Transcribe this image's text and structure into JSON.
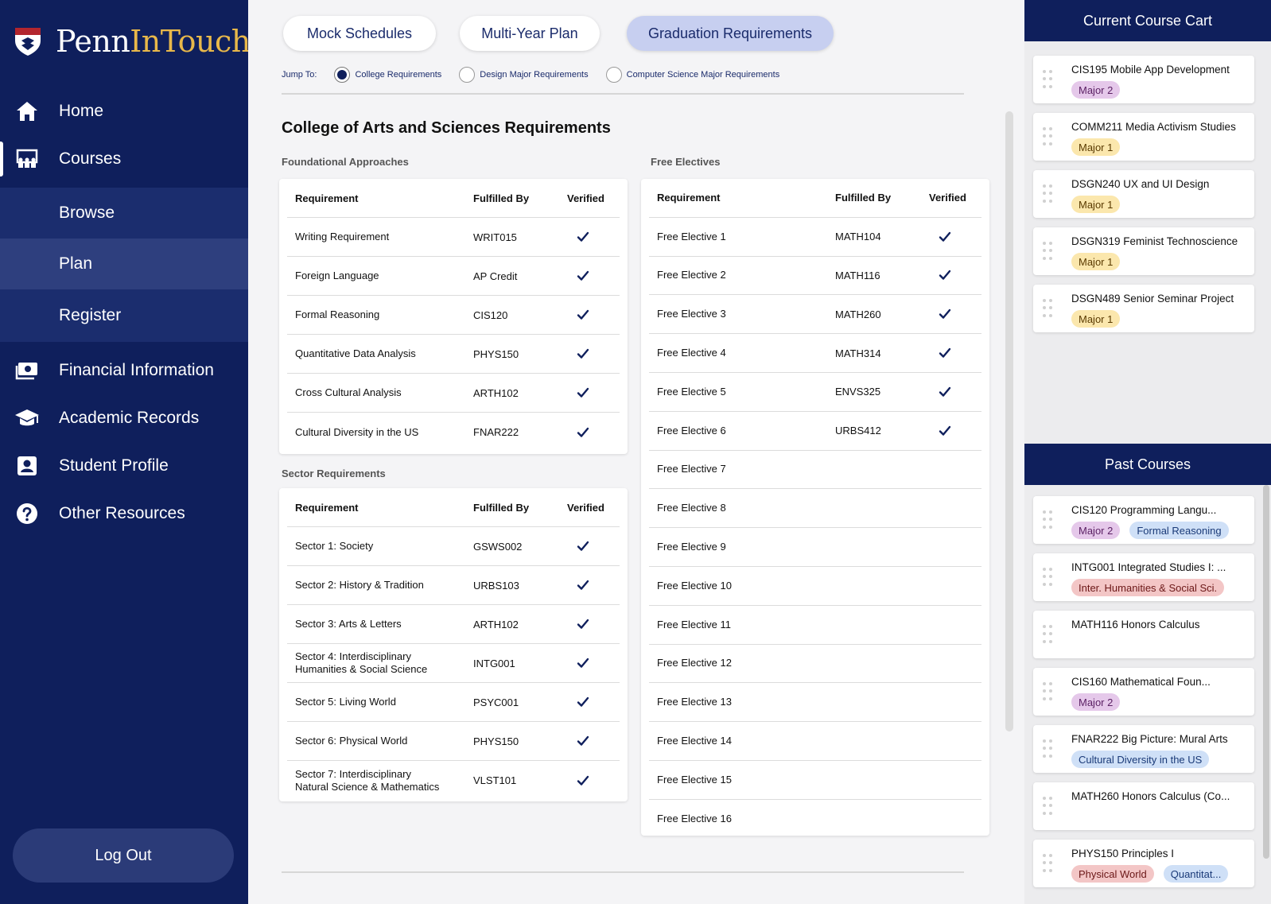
{
  "brand": {
    "part1": "Penn",
    "part2": "InTouch"
  },
  "nav": {
    "home": "Home",
    "courses": "Courses",
    "browse": "Browse",
    "plan": "Plan",
    "register": "Register",
    "financial": "Financial Information",
    "academic": "Academic Records",
    "profile": "Student Profile",
    "other": "Other Resources",
    "logout": "Log Out"
  },
  "tabs": [
    "Mock Schedules",
    "Multi-Year Plan",
    "Graduation Requirements"
  ],
  "jump": {
    "label": "Jump To:",
    "options": [
      "College Requirements",
      "Design Major Requirements",
      "Computer Science Major Requirements"
    ]
  },
  "page_title": "College of Arts and Sciences Requirements",
  "foundational": {
    "label": "Foundational Approaches",
    "headers": [
      "Requirement",
      "Fulfilled By",
      "Verified"
    ],
    "rows": [
      [
        "Writing Requirement",
        "WRIT015"
      ],
      [
        "Foreign Language",
        "AP Credit"
      ],
      [
        "Formal Reasoning",
        "CIS120"
      ],
      [
        "Quantitative Data Analysis",
        "PHYS150"
      ],
      [
        "Cross Cultural Analysis",
        "ARTH102"
      ],
      [
        "Cultural Diversity in the US",
        "FNAR222"
      ]
    ]
  },
  "sector": {
    "label": "Sector Requirements",
    "headers": [
      "Requirement",
      "Fulfilled By",
      "Verified"
    ],
    "rows": [
      [
        "Sector 1: Society",
        "GSWS002"
      ],
      [
        "Sector 2: History & Tradition",
        "URBS103"
      ],
      [
        "Sector 3: Arts & Letters",
        "ARTH102"
      ],
      [
        "Sector 4: Interdisciplinary",
        "INTG001",
        "Humanities & Social Science"
      ],
      [
        "Sector 5: Living World",
        "PSYC001"
      ],
      [
        "Sector 6: Physical World",
        "PHYS150"
      ],
      [
        "Sector 7: Interdisciplinary",
        "VLST101",
        "Natural Science & Mathematics"
      ]
    ]
  },
  "free": {
    "label": "Free Electives",
    "headers": [
      "Requirement",
      "Fulfilled By",
      "Verified"
    ],
    "rows": [
      [
        "Free Elective 1",
        "MATH104"
      ],
      [
        "Free Elective 2",
        "MATH116"
      ],
      [
        "Free Elective 3",
        "MATH260"
      ],
      [
        "Free Elective 4",
        "MATH314"
      ],
      [
        "Free Elective 5",
        "ENVS325"
      ],
      [
        "Free Elective 6",
        "URBS412"
      ],
      [
        "Free Elective 7",
        ""
      ],
      [
        "Free Elective 8",
        ""
      ],
      [
        "Free Elective 9",
        ""
      ],
      [
        "Free Elective 10",
        ""
      ],
      [
        "Free Elective 11",
        ""
      ],
      [
        "Free Elective 12",
        ""
      ],
      [
        "Free Elective 13",
        ""
      ],
      [
        "Free Elective 14",
        ""
      ],
      [
        "Free Elective 15",
        ""
      ],
      [
        "Free Elective 16",
        ""
      ]
    ]
  },
  "cart": {
    "title": "Current Course Cart",
    "items": [
      {
        "title": "CIS195 Mobile App Development",
        "badges": [
          "Major 2"
        ]
      },
      {
        "title": "COMM211 Media Activism Studies",
        "badges": [
          "Major 1"
        ]
      },
      {
        "title": "DSGN240 UX and UI Design",
        "badges": [
          "Major 1"
        ]
      },
      {
        "title": "DSGN319 Feminist Technoscience",
        "badges": [
          "Major 1"
        ]
      },
      {
        "title": "DSGN489 Senior Seminar Project",
        "badges": [
          "Major 1"
        ]
      }
    ]
  },
  "past": {
    "title": "Past Courses",
    "items": [
      {
        "title": "CIS120 Programming Langu...",
        "badges": [
          "Major 2",
          "Formal Reasoning"
        ]
      },
      {
        "title": "INTG001 Integrated Studies I: ...",
        "badges": [
          "Inter. Humanities & Social Sci."
        ]
      },
      {
        "title": "MATH116 Honors Calculus",
        "badges": []
      },
      {
        "title": "CIS160 Mathematical Foun...",
        "badges": [
          "Major 2"
        ]
      },
      {
        "title": "FNAR222 Big Picture: Mural Arts",
        "badges": [
          "Cultural Diversity in the US"
        ]
      },
      {
        "title": "MATH260 Honors Calculus (Co...",
        "badges": []
      },
      {
        "title": "PHYS150 Principles I",
        "badges": [
          "Physical World",
          "Quantitat..."
        ]
      }
    ]
  },
  "colors": {
    "navy": "#0f1f5c",
    "gold": "#e8b84a",
    "major2": "#e5c8ea",
    "major1": "#fbe7ad",
    "blue_badge": "#cfe0f7",
    "red_badge": "#f3c6c6"
  }
}
